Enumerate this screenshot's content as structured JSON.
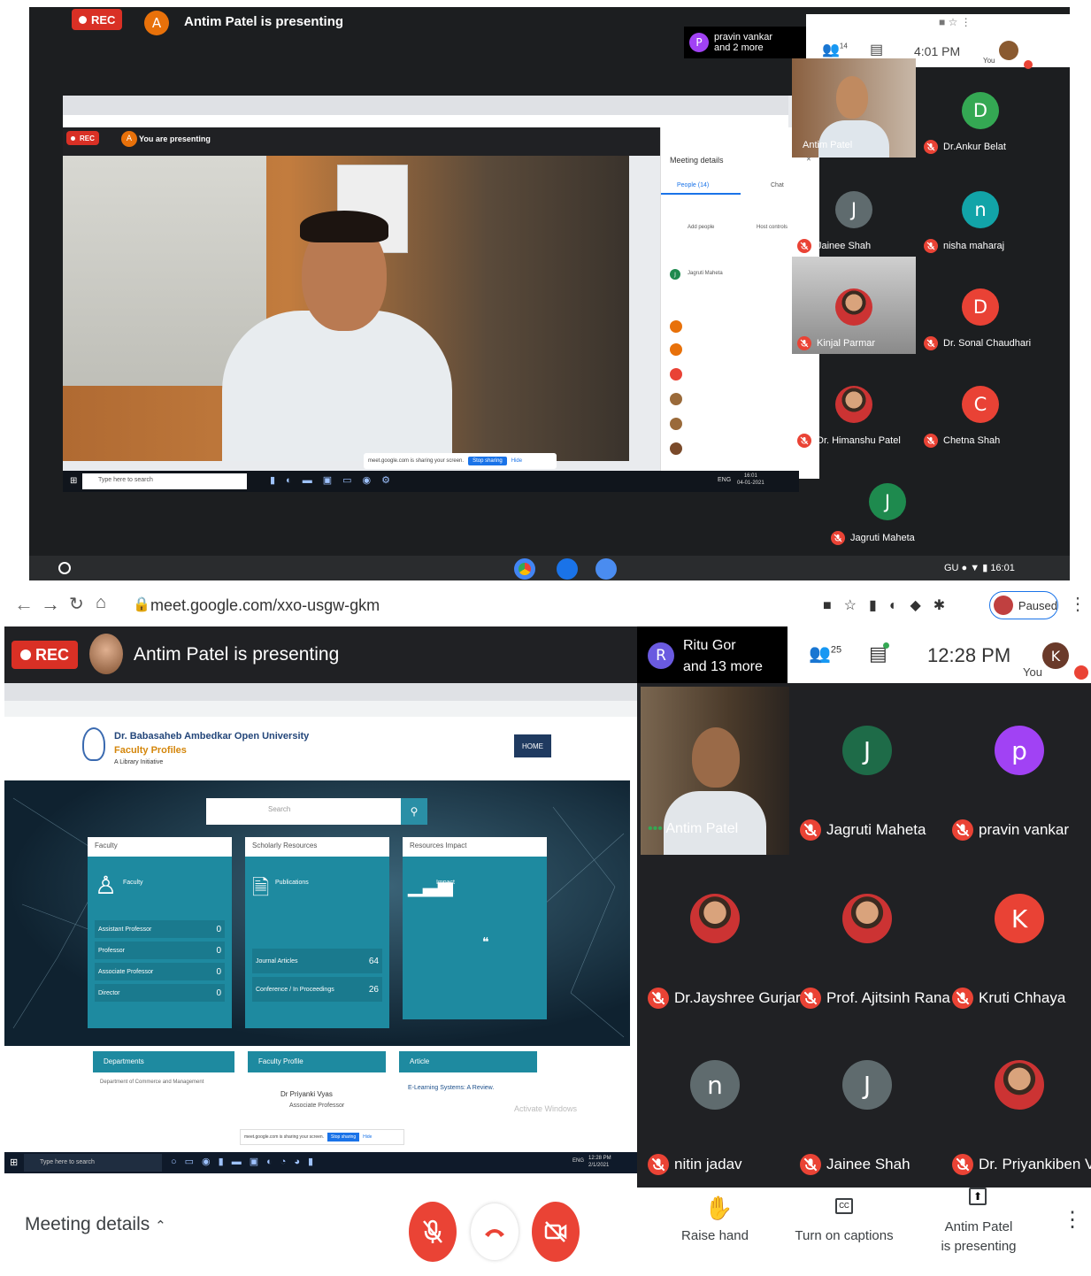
{
  "top": {
    "rec": "REC",
    "presenter_initial": "A",
    "presenting_text": "Antim Patel is presenting",
    "tile_label_initial": "P",
    "tile_label_line1": "pravin vankar",
    "tile_label_line2": "and 2 more",
    "people_count": "14",
    "time": "4:01 PM",
    "you": "You",
    "inner": {
      "rec": "REC",
      "initial": "A",
      "presenting": "You are presenting",
      "meeting_details": "Meeting details",
      "people_tab": "People (14)",
      "chat_tab": "Chat",
      "add_people": "Add people",
      "host_controls": "Host controls",
      "first_person": "Jagruti Maheta",
      "search_placeholder": "Type here to search",
      "sharing_text": "meet.google.com is sharing your screen.",
      "stop_sharing": "Stop sharing",
      "hide": "Hide",
      "taskbar_time": "16:01",
      "taskbar_date": "04-01-2021",
      "lang": "ENG"
    },
    "main_tile_name": "Antim Patel",
    "participants": [
      {
        "name": "Dr.Ankur Belat",
        "initial": "D",
        "color": "#34a853"
      },
      {
        "name": "Jainee Shah",
        "initial": "J",
        "color": "#5f6b6e"
      },
      {
        "name": "nisha maharaj",
        "initial": "n",
        "color": "#12a4a8"
      },
      {
        "name": "Kinjal Parmar",
        "initial": "",
        "color": ""
      },
      {
        "name": "Dr. Sonal Chaudhari",
        "initial": "D",
        "color": "#e94235"
      },
      {
        "name": "Dr. Himanshu Patel",
        "initial": "",
        "color": ""
      },
      {
        "name": "Chetna Shah",
        "initial": "C",
        "color": "#e94235"
      },
      {
        "name": "Jagruti Maheta",
        "initial": "J",
        "color": "#1e8a4e"
      }
    ],
    "shelf": {
      "lang": "GU",
      "time": "16:01"
    }
  },
  "bottom": {
    "url": "meet.google.com/xxo-usgw-gkm",
    "paused": "Paused",
    "rec": "REC",
    "presenting_text": "Antim Patel is presenting",
    "tile_label_initial": "R",
    "tile_label_line1": "Ritu Gor",
    "tile_label_line2": "and 13 more",
    "people_count": "25",
    "time": "12:28 PM",
    "you": "You",
    "you_initial": "K",
    "main_tile_name": "Antim Patel",
    "participants": [
      {
        "name": "Jagruti Maheta",
        "initial": "J",
        "color": "#1e6b48"
      },
      {
        "name": "pravin vankar",
        "initial": "p",
        "color": "#a142f4"
      },
      {
        "name": "Dr.Jayshree Gurjar",
        "initial": "",
        "color": ""
      },
      {
        "name": "Prof. Ajitsinh Rana",
        "initial": "",
        "color": ""
      },
      {
        "name": "Kruti Chhaya",
        "initial": "K",
        "color": "#e94235"
      },
      {
        "name": "nitin jadav",
        "initial": "n",
        "color": "#5f6b6e"
      },
      {
        "name": "Jainee Shah",
        "initial": "J",
        "color": "#5f6b6e"
      },
      {
        "name": "Dr. Priyankiben Vyas",
        "initial": "",
        "color": ""
      }
    ],
    "site": {
      "uni_name": "Dr. Babasaheb Ambedkar Open University",
      "faculty_profiles": "Faculty Profiles",
      "library": "A Library Initiative",
      "home": "HOME",
      "search_placeholder": "Search",
      "card1_title": "Faculty",
      "card1_label": "Faculty",
      "card1_rows": [
        {
          "label": "Assistant Professor",
          "value": "0"
        },
        {
          "label": "Professor",
          "value": "0"
        },
        {
          "label": "Associate Professor",
          "value": "0"
        },
        {
          "label": "Director",
          "value": "0"
        }
      ],
      "card2_title": "Scholarly Resources",
      "card2_label": "Publications",
      "card2_rows": [
        {
          "label": "Journal Articles",
          "value": "64"
        },
        {
          "label": "Conference / In Proceedings",
          "value": "26"
        }
      ],
      "card3_title": "Resources Impact",
      "card3_label": "Impact",
      "departments": "Departments",
      "dept_item": "Department of Commerce and Management",
      "faculty_profile": "Faculty Profile",
      "profile_name": "Dr Priyanki Vyas",
      "profile_role": "Associate Professor",
      "article": "Article",
      "article_item": "E-Learning Systems: A Review.",
      "activate_windows": "Activate Windows",
      "sharing_text": "meet.google.com is sharing your screen.",
      "stop_sharing": "Stop sharing",
      "hide": "Hide",
      "taskbar_search": "Type here to search",
      "taskbar_lang": "ENG",
      "taskbar_time": "12:28 PM",
      "taskbar_date": "2/1/2021"
    },
    "controls": {
      "meeting_details": "Meeting details",
      "raise_hand": "Raise hand",
      "captions": "Turn on captions",
      "presenting_line1": "Antim Patel",
      "presenting_line2": "is presenting"
    }
  }
}
